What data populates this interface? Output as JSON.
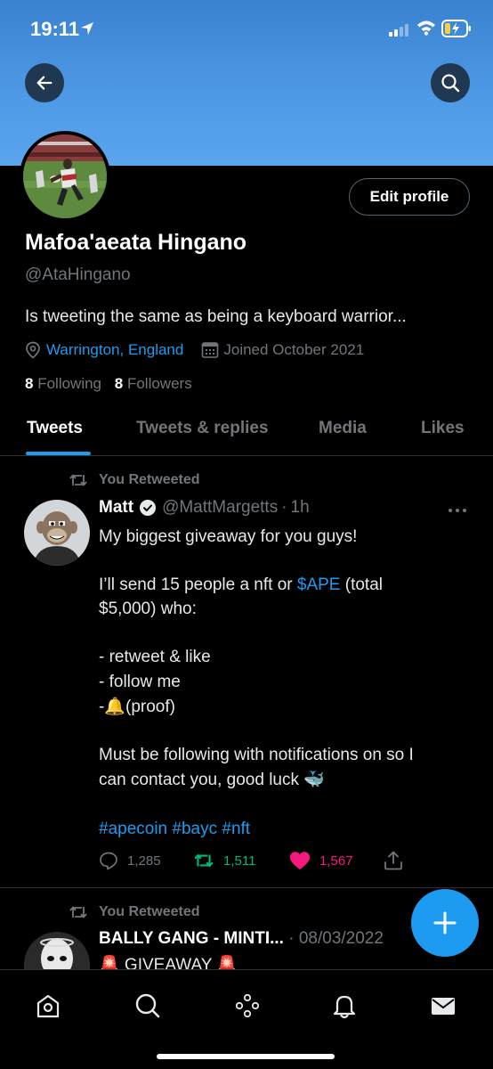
{
  "status_bar": {
    "time": "19:11"
  },
  "profile": {
    "name": "Mafoa'aeata Hingano",
    "handle": "@AtaHingano",
    "bio": "Is tweeting the same as being a keyboard warrior...",
    "location": "Warrington, England",
    "joined": "Joined October 2021",
    "following_count": "8",
    "following_label": "Following",
    "followers_count": "8",
    "followers_label": "Followers",
    "edit_label": "Edit profile"
  },
  "tabs": [
    {
      "label": "Tweets",
      "active": true
    },
    {
      "label": "Tweets & replies",
      "active": false
    },
    {
      "label": "Media",
      "active": false
    },
    {
      "label": "Likes",
      "active": false
    }
  ],
  "tweets": [
    {
      "retweet_label": "You Retweeted",
      "name": "Matt",
      "handle": "@MattMargetts",
      "separator": "·",
      "time": "1h",
      "lines": {
        "l1": "My biggest giveaway for you guys!",
        "l2_pre": "I’ll send 15 people a nft or ",
        "l2_tag": "$APE",
        "l2_post": " (total",
        "l3": "$5,000) who:",
        "l4": "- retweet & like",
        "l5": "- follow me",
        "l6_pre": "-",
        "l6_emoji": "🔔",
        "l6_post": "(proof)",
        "l7": "Must be following with notifications on so I",
        "l8_pre": "can contact you, good luck ",
        "l8_emoji": "🐳",
        "tag1": "#apecoin",
        "tag2": "#bayc",
        "tag3": "#nft"
      },
      "replies": "1,285",
      "retweets": "1,511",
      "likes": "1,567"
    },
    {
      "retweet_label": "You Retweeted",
      "name": "BALLY GANG - MINTI...",
      "separator": "·",
      "date": "08/03/2022",
      "text": "🚨 GIVEAWAY 🚨"
    }
  ],
  "colors": {
    "accent": "#1d9bf0",
    "retweet_green": "#00ba7c",
    "like_pink": "#f91880",
    "banner": "#4f9ae6"
  },
  "icons": [
    "back-arrow-icon",
    "search-icon",
    "location-pin-icon",
    "calendar-icon",
    "retweet-icon",
    "verified-badge-icon",
    "more-icon",
    "reply-icon",
    "heart-icon",
    "share-icon",
    "compose-plus-icon",
    "home-icon",
    "explore-icon",
    "spaces-icon",
    "bell-icon",
    "mail-icon"
  ]
}
